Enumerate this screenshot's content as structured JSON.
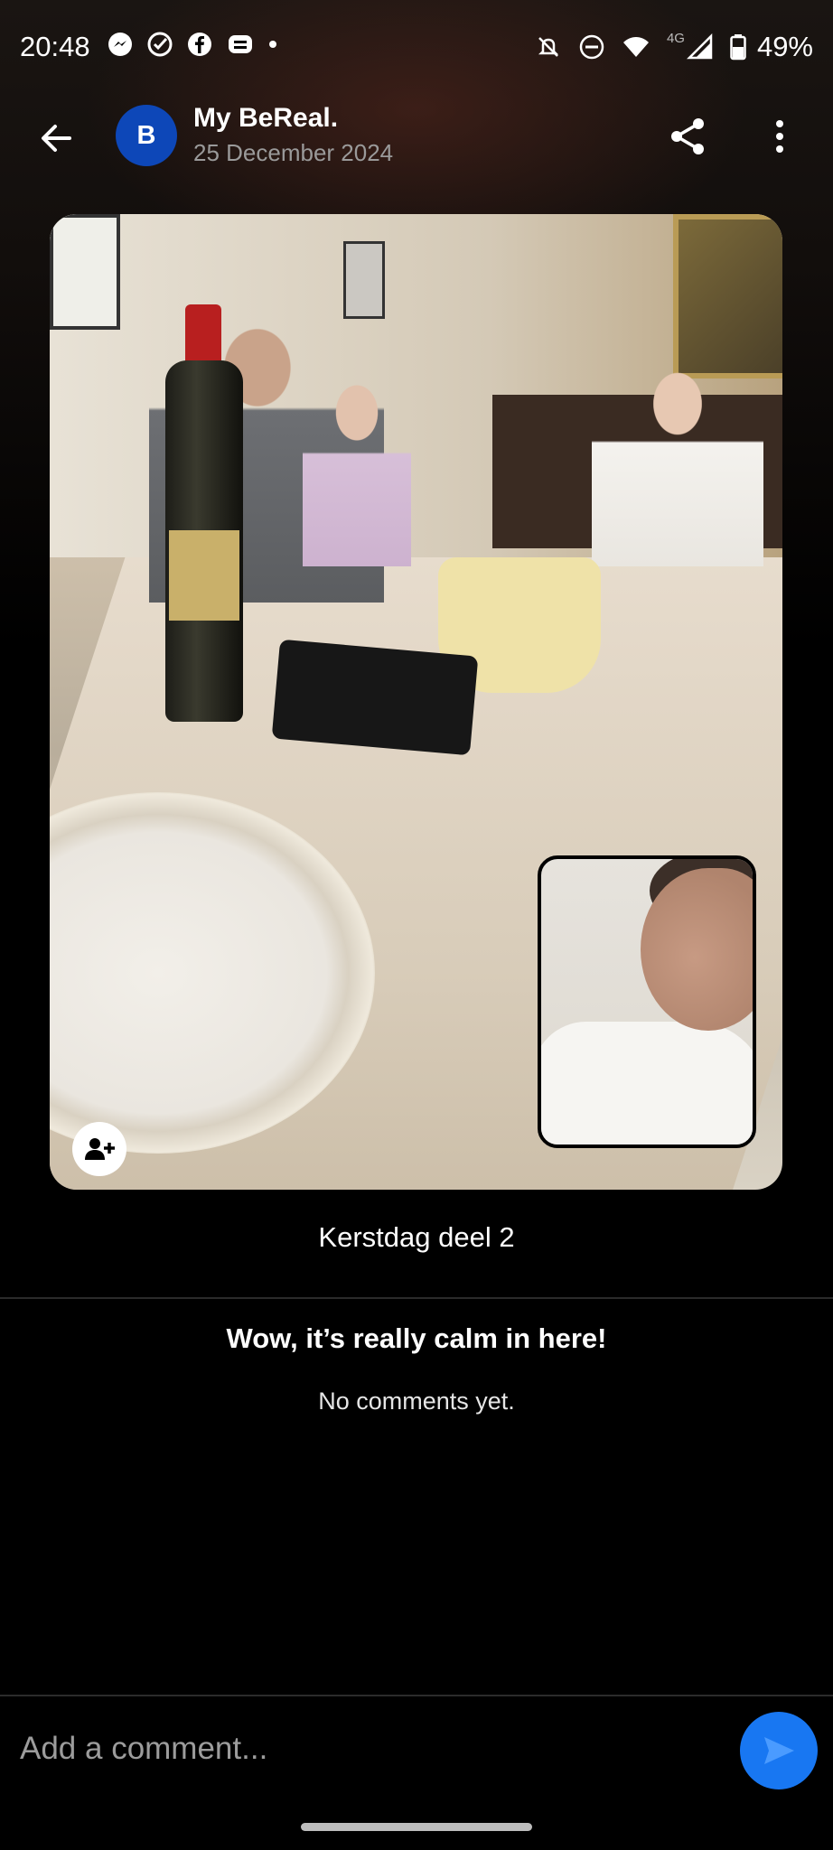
{
  "status_bar": {
    "time": "20:48",
    "left_icons": [
      "messenger-icon",
      "check-circle-icon",
      "facebook-icon",
      "printer-icon",
      "dot-icon"
    ],
    "right_icons": [
      "bell-off-icon",
      "do-not-disturb-icon",
      "wifi-icon",
      "cellular-signal-icon",
      "battery-icon"
    ],
    "network": "4G",
    "battery": "49%"
  },
  "header": {
    "avatar_letter": "B",
    "title": "My BeReal.",
    "date": "25 December 2024"
  },
  "post": {
    "caption": "Kerstdag deel 2"
  },
  "comments": {
    "empty_title": "Wow, it’s really calm in here!",
    "empty_subtitle": "No comments yet."
  },
  "composer": {
    "placeholder": "Add a comment..."
  },
  "colors": {
    "accent": "#1877f2",
    "avatar_bg": "#0d47b8",
    "background": "#000000"
  }
}
